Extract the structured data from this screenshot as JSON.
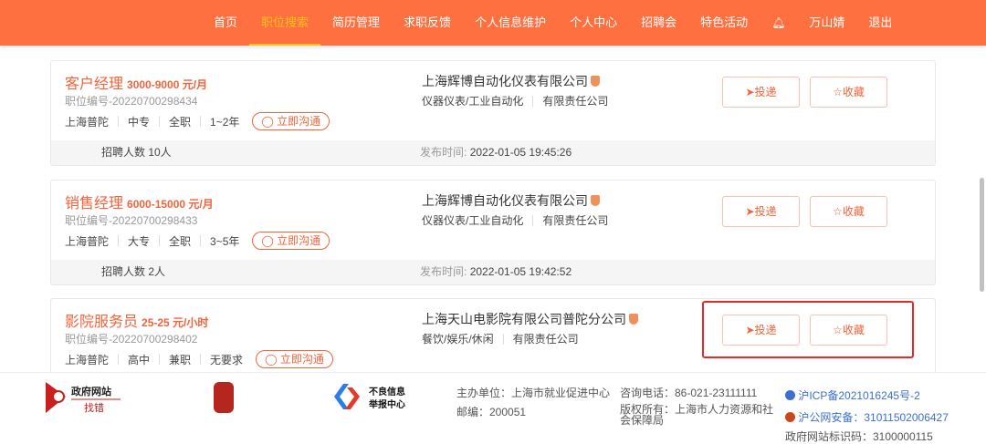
{
  "nav": [
    "首页",
    "职位搜索",
    "简历管理",
    "求职反馈",
    "个人信息维护",
    "个人中心",
    "招聘会",
    "特色活动",
    "🔔",
    "万山婧",
    "退出"
  ],
  "nav_active": 1,
  "jobs": [
    {
      "title": "客户经理",
      "salary": "3000-9000 元/月",
      "code": "职位编号-20220700298434",
      "tags": [
        "上海普陀",
        "中专",
        "全职",
        "1~2年"
      ],
      "chat": "立即沟通",
      "company": "上海辉博自动化仪表有限公司",
      "industry": "仪器仪表/工业自动化",
      "type": "有限责任公司",
      "apply": "投递",
      "fav": "收藏",
      "count": "招聘人数 10人",
      "pub_label": "发布时间:",
      "pub_time": "2022-01-05 19:45:26"
    },
    {
      "title": "销售经理",
      "salary": "6000-15000 元/月",
      "code": "职位编号-20220700298433",
      "tags": [
        "上海普陀",
        "大专",
        "全职",
        "3~5年"
      ],
      "chat": "立即沟通",
      "company": "上海辉博自动化仪表有限公司",
      "industry": "仪器仪表/工业自动化",
      "type": "有限责任公司",
      "apply": "投递",
      "fav": "收藏",
      "count": "招聘人数 2人",
      "pub_label": "发布时间:",
      "pub_time": "2022-01-05 19:42:52"
    },
    {
      "title": "影院服务员",
      "salary": "25-25 元/小时",
      "code": "职位编号-20220700298402",
      "tags": [
        "上海普陀",
        "高中",
        "兼职",
        "无要求"
      ],
      "chat": "立即沟通",
      "company": "上海天山电影院有限公司普陀分公司",
      "industry": "餐饮/娱乐/休闲",
      "type": "有限责任公司",
      "apply": "投递",
      "fav": "收藏",
      "count": "",
      "pub_label": "",
      "pub_time": ""
    }
  ],
  "footer": {
    "gov_logo": "政府网站 找错",
    "report_logo": "不良信息 举报中心",
    "host": "主办单位：上海市就业促进中心",
    "phone": "咨询电话：86-021-23111111",
    "zip": "邮编：200051",
    "copyright": "版权所有：上海市人力资源和社会保障局",
    "icp": "沪ICP备2021016245号-2",
    "police": "沪公网安备：31011502006427",
    "site_code": "政府网站标识码：3100000115"
  }
}
